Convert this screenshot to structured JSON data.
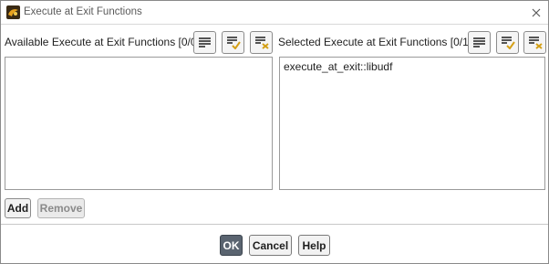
{
  "window": {
    "title": "Execute at Exit Functions",
    "close_icon": "close-icon",
    "app_icon": "fluent-app-icon"
  },
  "available": {
    "label": "Available Execute at Exit Functions [0/0]",
    "items": []
  },
  "selected": {
    "label": "Selected Execute at Exit Functions [0/1]",
    "items": [
      "execute_at_exit::libudf"
    ]
  },
  "icons": {
    "list": "list-icon",
    "select_all": "select-all-icon",
    "deselect_all": "deselect-all-icon"
  },
  "actions": {
    "add": "Add",
    "remove": "Remove"
  },
  "buttons": {
    "ok": "OK",
    "cancel": "Cancel",
    "help": "Help"
  },
  "colors": {
    "accent_check": "#d4a017",
    "accent_x": "#d4a017",
    "primary_button": "#5a6470"
  }
}
